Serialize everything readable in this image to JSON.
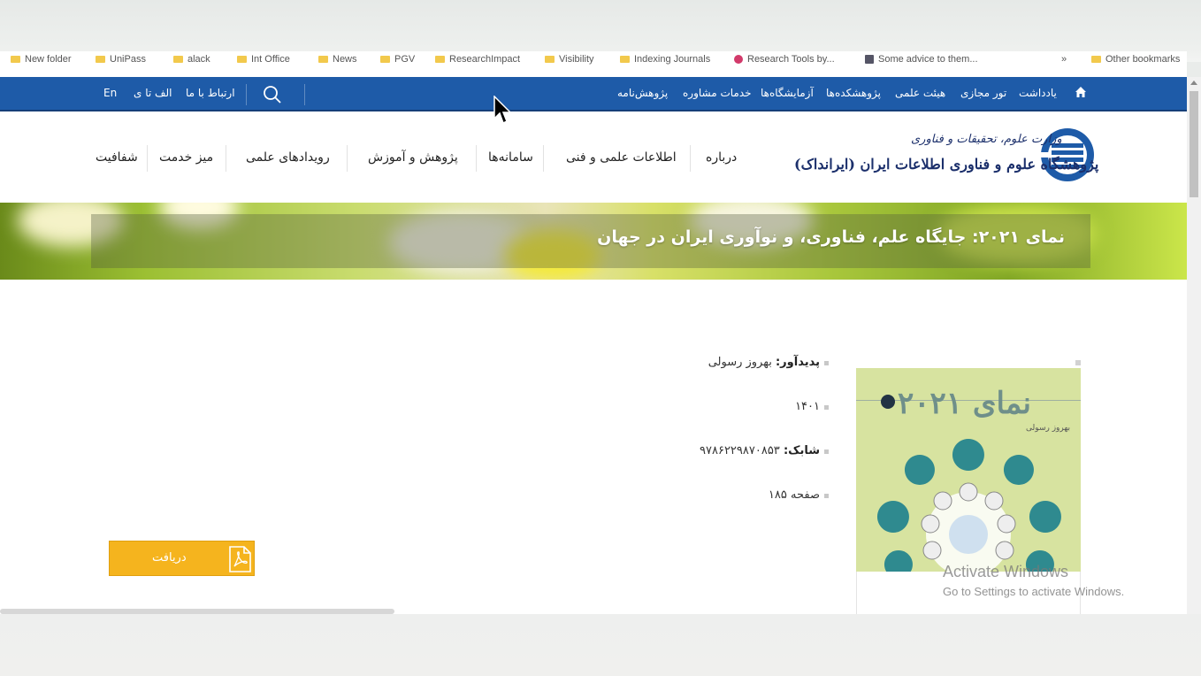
{
  "bookmarks": [
    {
      "label": "New folder",
      "type": "folder"
    },
    {
      "label": "UniPass",
      "type": "folder"
    },
    {
      "label": "alack",
      "type": "folder"
    },
    {
      "label": "Int Office",
      "type": "folder"
    },
    {
      "label": "News",
      "type": "folder"
    },
    {
      "label": "PGV",
      "type": "folder"
    },
    {
      "label": "ResearchImpact",
      "type": "folder"
    },
    {
      "label": "Visibility",
      "type": "folder"
    },
    {
      "label": "Indexing Journals",
      "type": "folder"
    },
    {
      "label": "Research Tools by...",
      "type": "site"
    },
    {
      "label": "Some advice to them...",
      "type": "site"
    },
    {
      "label": "Other bookmarks",
      "type": "folder"
    }
  ],
  "topnav": {
    "home_icon": "home-icon",
    "items": [
      "یادداشت",
      "تور مجازی",
      "هیئت علمی",
      "پژوهشکده‌ها",
      "آزمایشگاه‌ها",
      "خدمات مشاوره",
      "پژوهش‌نامه"
    ],
    "alefba": "الف تا ی",
    "contact": "ارتباط با ما",
    "lang": "En",
    "search_icon": "search-icon"
  },
  "header": {
    "org_sub": "وزارت علوم، تحقیقات و فناوری",
    "org_name": "پژوهشگاه علوم و فناوری اطلاعات ایران (ایرانداک)",
    "nav": [
      "درباره",
      "اطلاعات علمی و فنی",
      "سامانه‌ها",
      "پژوهش و آموزش",
      "رویدادهای علمی",
      "میز خدمت",
      "شفافیت"
    ]
  },
  "banner": {
    "title": "نمای ۲۰۲۱: جایگاه علم، فناوری، و نوآوری ایران در جهان"
  },
  "book": {
    "creator_label": "پدیدآور:",
    "creator": "بهروز رسولی",
    "year": "۱۴۰۱",
    "isbn_label": "شابک:",
    "isbn": "۹۷۸۶۲۲۹۸۷۰۸۵۳",
    "pages": "۱۸۵ صفحه",
    "cover_title": "نمای ۲۰۲۱",
    "cover_author": "بهروز رسولی",
    "download": "دریافت"
  },
  "watermark": {
    "title": "Activate Windows",
    "subtitle": "Go to Settings to activate Windows."
  },
  "colors": {
    "nav_blue": "#1e5ba8",
    "download_yellow": "#f5b41e",
    "banner_green": "#9bbf32"
  }
}
